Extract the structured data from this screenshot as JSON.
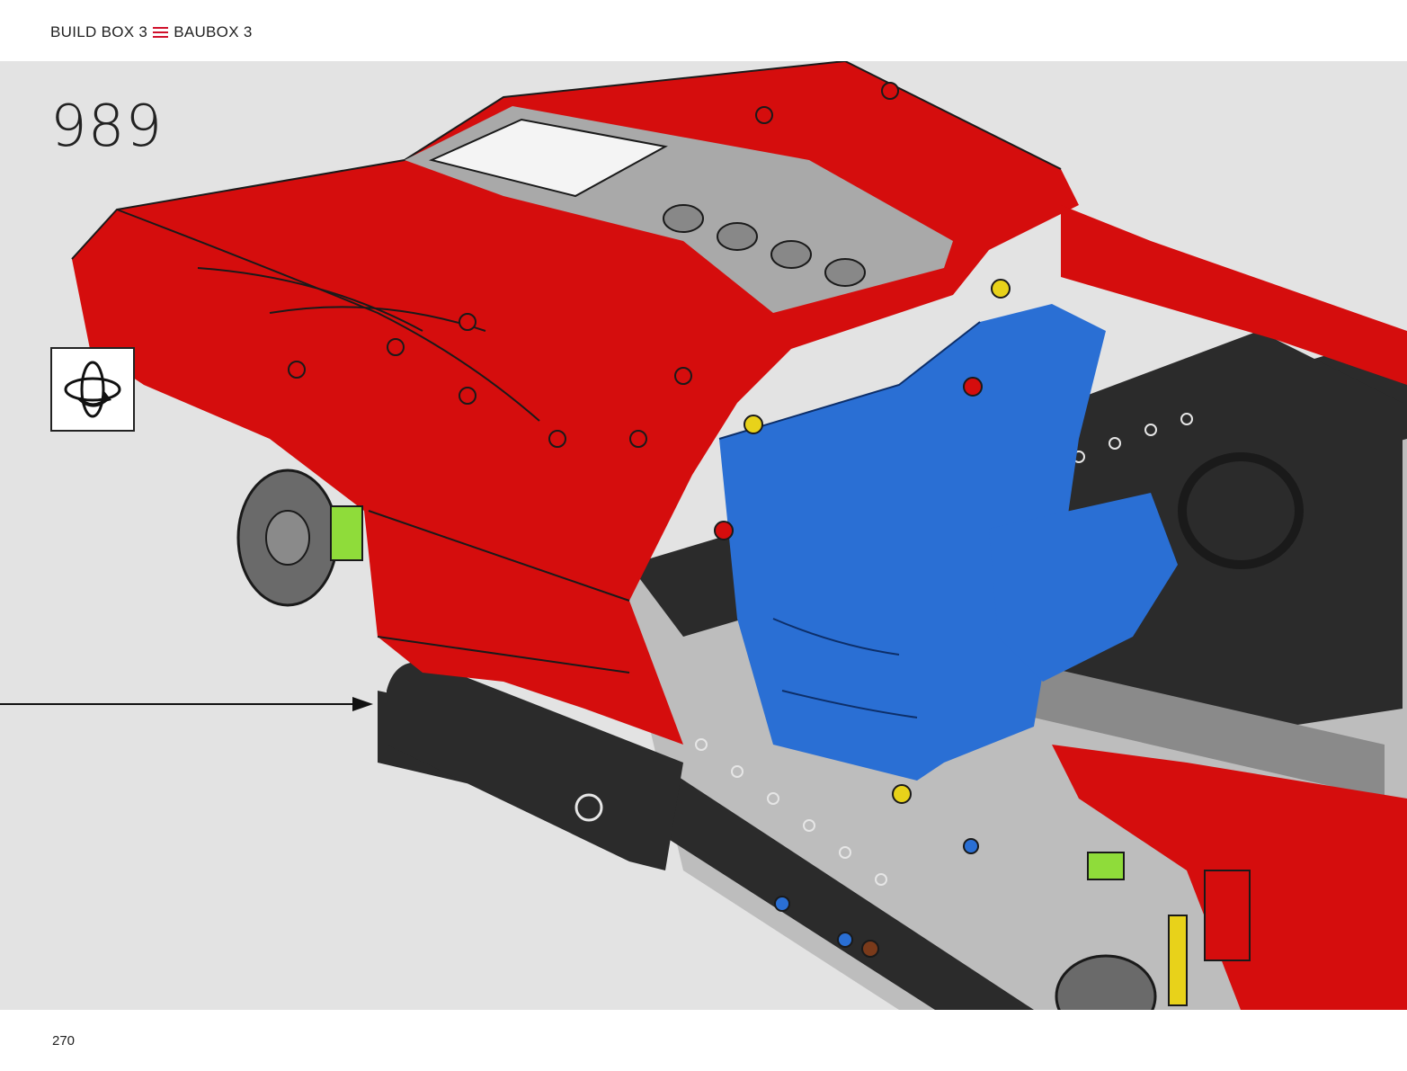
{
  "header": {
    "build_box_en": "BUILD BOX 3",
    "build_box_de": "BAUBOX 3",
    "flag_icon": "stripes-icon"
  },
  "step": {
    "number": "989"
  },
  "rotate_icon": "rotate-model-icon",
  "footer": {
    "page_number": "270"
  },
  "colors": {
    "background": "#e3e3e3",
    "body_red": "#d50d0d",
    "seat_blue": "#2a6fd4",
    "frame_black": "#2b2b2b",
    "light_gray": "#b9b9b9",
    "lime": "#8fdc3a",
    "accent_red_stripe": "#d0102b"
  }
}
